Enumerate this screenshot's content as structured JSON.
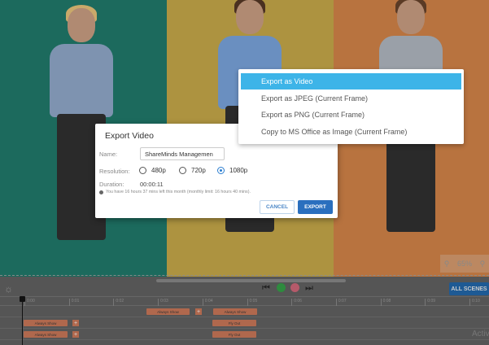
{
  "stage": {
    "zoom_level": "65%",
    "colors": {
      "panel1": "#1c6a5d",
      "panel2": "#ad9340",
      "panel3": "#b8733f"
    }
  },
  "toolbar": {
    "all_scenes_label": "ALL SCENES",
    "icons": [
      "brightness-icon",
      "skip-back-icon",
      "play-icon",
      "stop-icon",
      "skip-forward-icon"
    ]
  },
  "timeline": {
    "ticks": [
      "0:00",
      "0:01",
      "0:02",
      "0:03",
      "0:04",
      "0:05",
      "0:06",
      "0:07",
      "0:08",
      "0:09",
      "0:10"
    ],
    "tracks": [
      {
        "blocks": [
          "Always Show",
          "Always Show"
        ]
      },
      {
        "blocks": [
          "Always Show",
          "Fly Out"
        ]
      },
      {
        "blocks": [
          "Always Show",
          "Fly Out"
        ]
      }
    ]
  },
  "watermark": "Activ",
  "dialog": {
    "title": "Export Video",
    "name_label": "Name:",
    "name_value": "ShareMinds Managemen",
    "resolution_label": "Resolution:",
    "resolutions": [
      "480p",
      "720p",
      "1080p"
    ],
    "selected_resolution": "1080p",
    "duration_label": "Duration:",
    "duration_value": "00:00:11",
    "info": "You have 16 hours 37 mins left this month (monthly limit: 16 hours 40 mins).",
    "cancel_label": "CANCEL",
    "export_label": "EXPORT",
    "accent": "#2a6fbe"
  },
  "menu": {
    "items": [
      "Export as Video",
      "Export as JPEG (Current Frame)",
      "Export as PNG (Current Frame)",
      "Copy to MS Office as Image (Current Frame)"
    ],
    "selected": "Export as Video",
    "highlight": "#3db4e8"
  }
}
